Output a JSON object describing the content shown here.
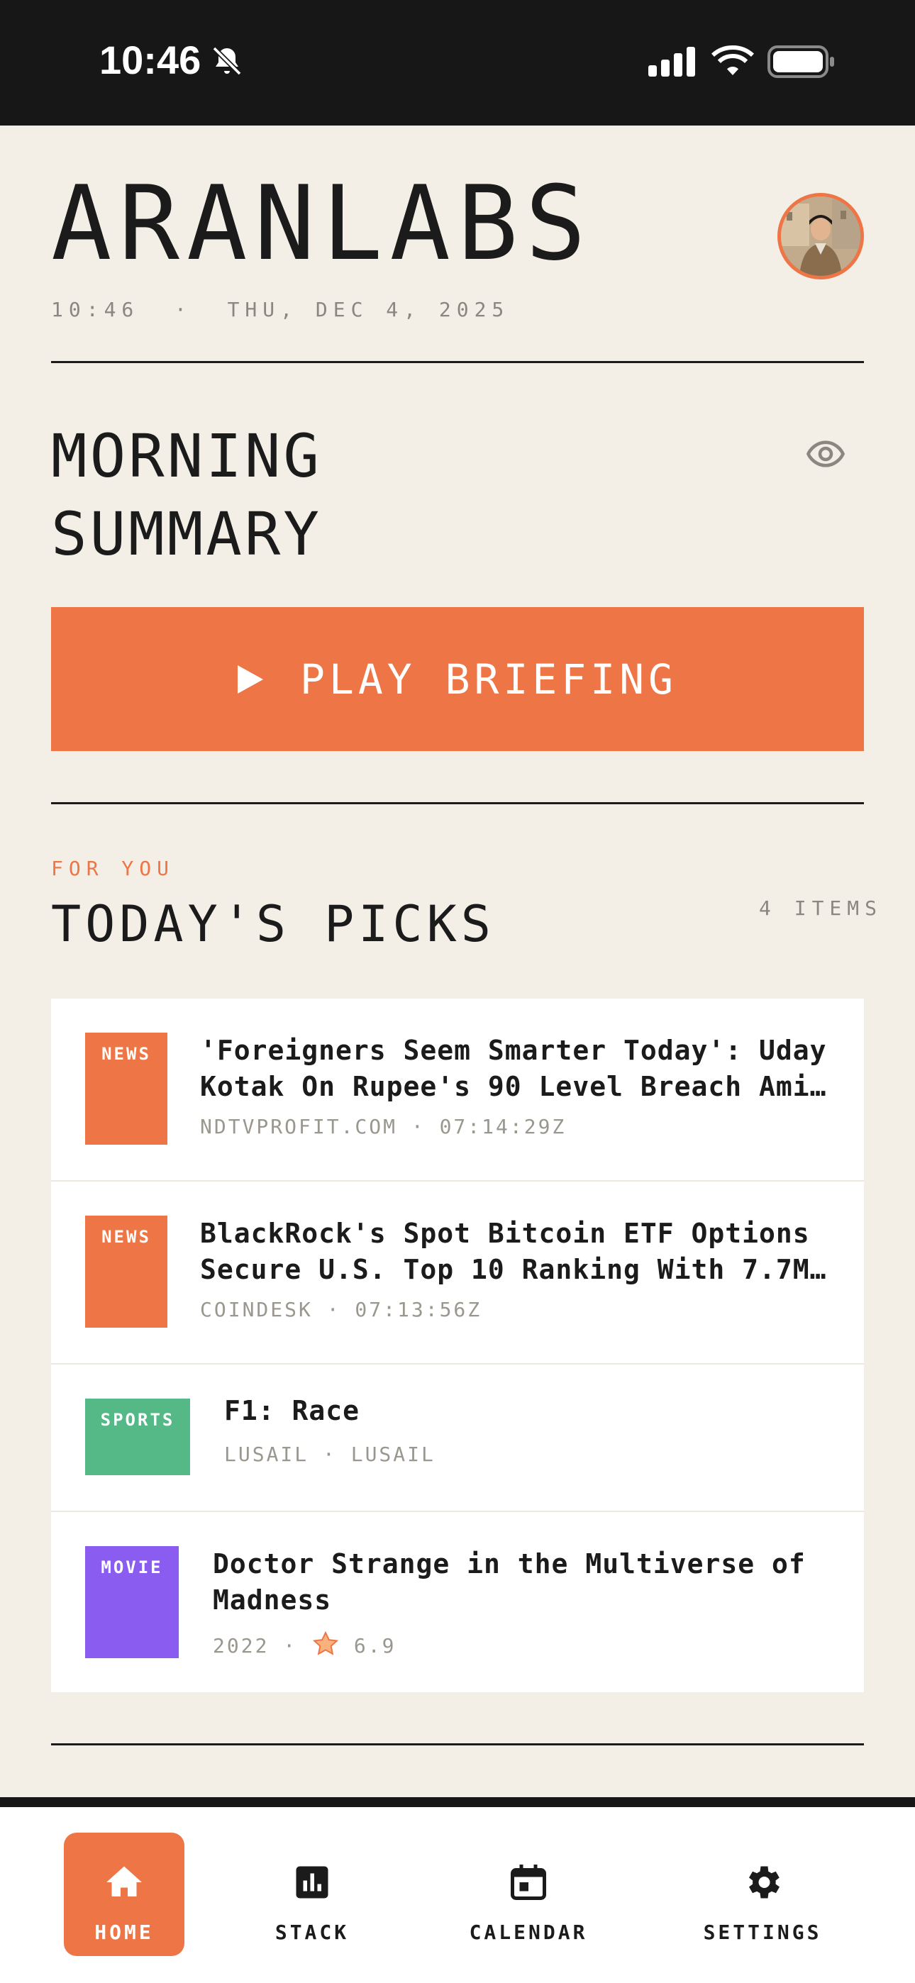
{
  "status_bar": {
    "time": "10:46",
    "icons": [
      "bell-slash-icon",
      "signal-icon",
      "wifi-icon",
      "battery-icon"
    ]
  },
  "header": {
    "brand": "ARANLABS",
    "datetime": "10:46  ·  THU, DEC 4, 2025",
    "avatar": "avatar"
  },
  "summary": {
    "title_line1": "MORNING",
    "title_line2": "SUMMARY",
    "visibility_icon": "eye-icon",
    "play_label": "PLAY BRIEFING"
  },
  "picks": {
    "eyebrow": "FOR YOU",
    "title": "TODAY'S PICKS",
    "count": "4 ITEMS",
    "items": [
      {
        "tag": "NEWS",
        "title_line1": "'Foreigners Seem Smarter Today': Uday",
        "title_line2": "Kotak On Rupee's 90 Level Breach Ami…",
        "meta": "NDTVPROFIT.COM · 07:14:29Z"
      },
      {
        "tag": "NEWS",
        "title_line1": "BlackRock's Spot Bitcoin ETF Options",
        "title_line2": "Secure U.S. Top 10 Ranking With 7.7M…",
        "meta": "COINDESK · 07:13:56Z"
      },
      {
        "tag": "SPORTS",
        "title_line1": "F1: Race",
        "meta": "LUSAIL · LUSAIL"
      },
      {
        "tag": "MOVIE",
        "title_line1": "Doctor Strange in the Multiverse of",
        "title_line2": "Madness",
        "meta_year": "2022 ·",
        "meta_rating": "6.9"
      }
    ]
  },
  "colors": {
    "accent": "#ee7545",
    "background": "#f3efe7",
    "sports": "#54b987",
    "movie": "#8b5cf0"
  },
  "nav": {
    "items": [
      {
        "label": "HOME",
        "icon": "home-icon",
        "active": true
      },
      {
        "label": "STACK",
        "icon": "bar-chart-icon"
      },
      {
        "label": "CALENDAR",
        "icon": "calendar-icon"
      },
      {
        "label": "SETTINGS",
        "icon": "gear-icon"
      }
    ]
  }
}
